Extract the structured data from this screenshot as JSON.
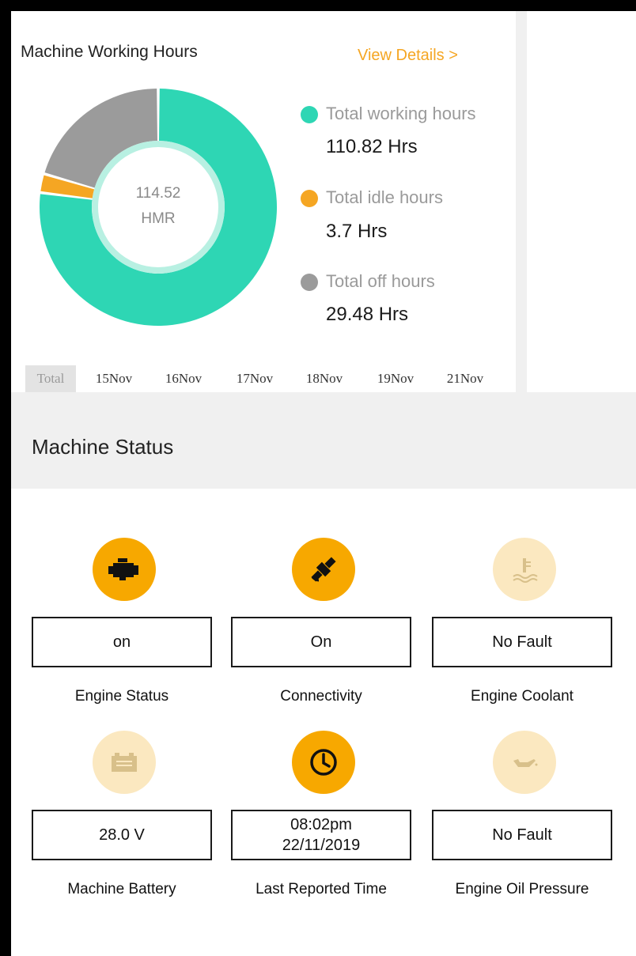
{
  "working_hours": {
    "title": "Machine Working Hours",
    "view_details": "View Details >",
    "center_value": "114.52",
    "center_unit": "HMR",
    "legend": [
      {
        "label": "Total working hours",
        "value": "110.82 Hrs",
        "color": "#2ed6b4"
      },
      {
        "label": "Total idle hours",
        "value": "3.7 Hrs",
        "color": "#f5a623"
      },
      {
        "label": "Total off hours",
        "value": "29.48 Hrs",
        "color": "#9b9b9b"
      }
    ],
    "tabs": [
      "Total",
      "15Nov",
      "16Nov",
      "17Nov",
      "18Nov",
      "19Nov",
      "21Nov"
    ],
    "active_tab": "Total"
  },
  "chart_data": {
    "type": "pie",
    "title": "Machine Working Hours",
    "labels": [
      "Total working hours",
      "Total idle hours",
      "Total off hours"
    ],
    "values": [
      110.82,
      3.7,
      29.48
    ],
    "colors": [
      "#2ed6b4",
      "#f5a623",
      "#9b9b9b"
    ],
    "center_text": "114.52 HMR"
  },
  "machine_status": {
    "title": "Machine Status",
    "items": [
      {
        "icon": "engine-icon",
        "state": "active",
        "value": "on",
        "caption": "Engine Status"
      },
      {
        "icon": "satellite-icon",
        "state": "active",
        "value": "On",
        "caption": "Connectivity"
      },
      {
        "icon": "coolant-temperature-icon",
        "state": "inactive",
        "value": "No Fault",
        "caption": "Engine Coolant"
      },
      {
        "icon": "battery-icon",
        "state": "inactive",
        "value": "28.0 V",
        "caption": "Machine Battery"
      },
      {
        "icon": "clock-icon",
        "state": "active",
        "value_line1": "08:02pm",
        "value_line2": "22/11/2019",
        "caption": "Last Reported Time"
      },
      {
        "icon": "oil-can-icon",
        "state": "inactive",
        "value": "No Fault",
        "caption": "Engine Oil Pressure"
      }
    ]
  }
}
